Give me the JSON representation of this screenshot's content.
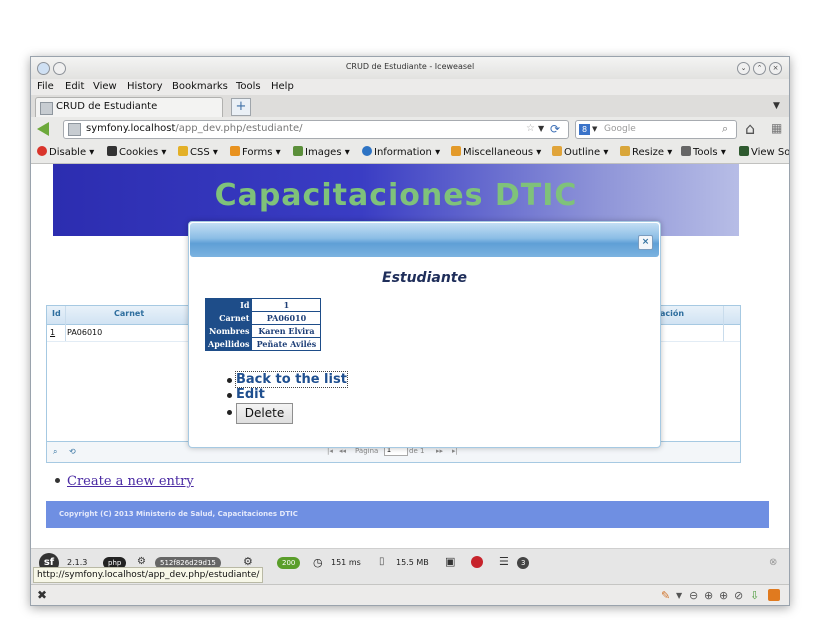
{
  "window": {
    "title": "CRUD de Estudiante - Iceweasel"
  },
  "menu": [
    "File",
    "Edit",
    "View",
    "History",
    "Bookmarks",
    "Tools",
    "Help"
  ],
  "tab": {
    "label": "CRUD de Estudiante",
    "new_tab": "+"
  },
  "address": {
    "host": "symfony.localhost",
    "path": "/app_dev.php/estudiante/"
  },
  "search": {
    "placeholder": "Google",
    "engine": "8"
  },
  "webdev": [
    "Disable",
    "Cookies",
    "CSS",
    "Forms",
    "Images",
    "Information",
    "Miscellaneous",
    "Outline",
    "Resize",
    "Tools",
    "View So"
  ],
  "page": {
    "banner": "Capacitaciones DTIC",
    "grid": {
      "headers": [
        "Id",
        "Carnet",
        "ación"
      ],
      "row": [
        "1",
        "PA06010"
      ],
      "pager": {
        "page_label": "Página",
        "page_value": "1",
        "of_label": "de 1"
      }
    },
    "new_entry": "Create a new entry",
    "footer": "Copyright (C) 2013 Ministerio de Salud, Capacitaciones DTIC"
  },
  "modal": {
    "title": "Estudiante",
    "close": "×",
    "record": [
      {
        "label": "Id",
        "value": "1"
      },
      {
        "label": "Carnet",
        "value": "PA06010"
      },
      {
        "label": "Nombres",
        "value": "Karen Elvira"
      },
      {
        "label": "Apellidos",
        "value": "Peñate Avilés"
      }
    ],
    "back_link": "Back to the list",
    "edit_link": "Edit",
    "delete_button": "Delete"
  },
  "profiler": {
    "version": "2.1.3",
    "php": "php",
    "token": "512f826d29d15",
    "status": "200",
    "time": "151 ms",
    "memory": "15.5 MB",
    "queries": "3"
  },
  "status_url": "http://symfony.localhost/app_dev.php/estudiante/"
}
